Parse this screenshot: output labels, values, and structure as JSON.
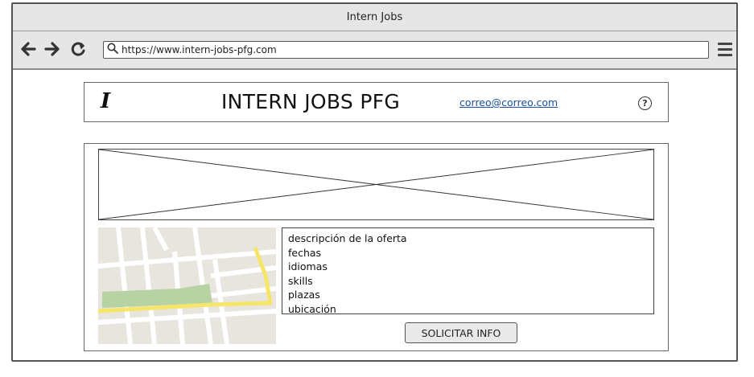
{
  "browser": {
    "window_title": "Intern Jobs",
    "url": "https://www.intern-jobs-pfg.com",
    "icons": {
      "back": "arrow-left-icon",
      "forward": "arrow-right-icon",
      "reload": "reload-icon",
      "search": "search-icon",
      "menu": "hamburger-menu-icon"
    }
  },
  "header": {
    "logo_letter": "I",
    "title": "INTERN JOBS PFG",
    "email": "correo@correo.com",
    "help_symbol": "?"
  },
  "offer": {
    "details": [
      "descripción de la oferta",
      "fechas",
      "idiomas",
      "skills",
      "plazas",
      "ubicación"
    ],
    "apply_label": "SOLICITAR INFO"
  },
  "colors": {
    "chrome_bg": "#e6e6e6",
    "link": "#1a4f9c",
    "map_road": "#ffffff",
    "map_bg": "#e8e5df",
    "map_park": "#b7d3a3",
    "map_highlight_road": "#f5e66a"
  }
}
